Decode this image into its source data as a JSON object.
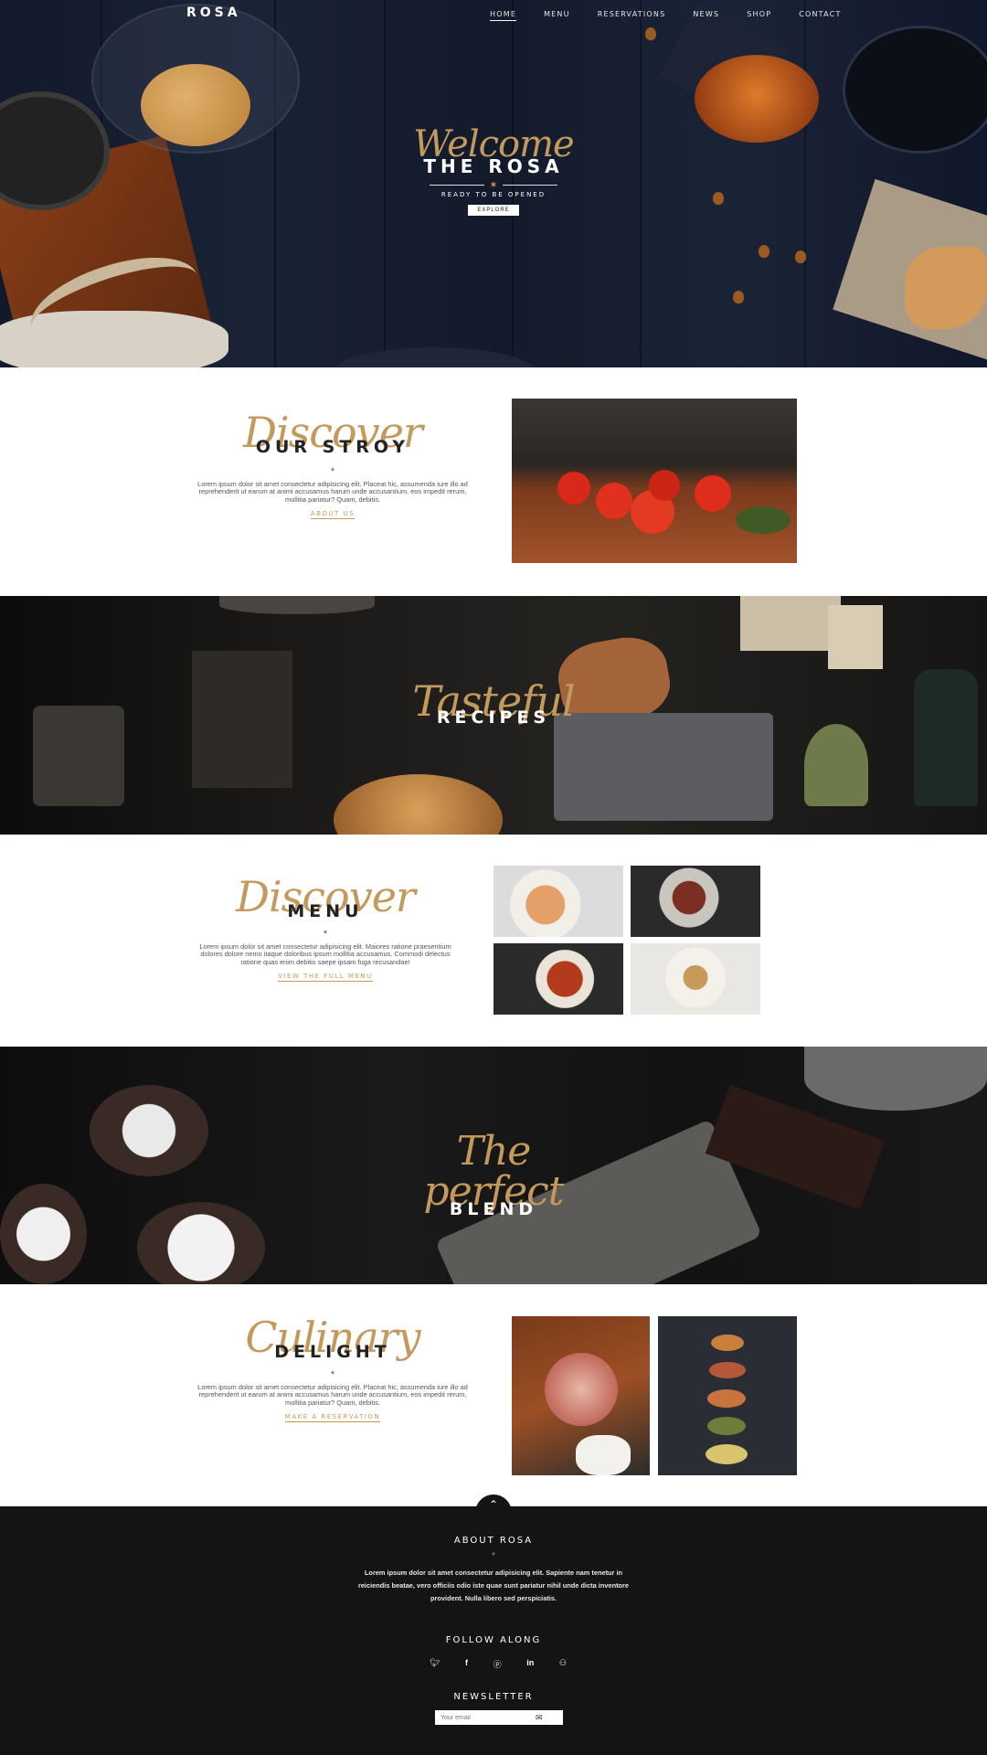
{
  "nav": {
    "logo": "ROSA",
    "items": [
      "HOME",
      "MENU",
      "RESERVATIONS",
      "NEWS",
      "SHOP",
      "CONTACT"
    ],
    "active": "HOME"
  },
  "hero": {
    "script": "Welcome",
    "title": "THE ROSA",
    "subtitle": "READY TO BE OPENED",
    "button": "EXPLORE"
  },
  "story": {
    "script": "Discover",
    "title": "OUR STROY",
    "star": "*",
    "text": "Lorem ipsum dolor sit amet consectetur adipisicing elit. Placeat hic, assumenda iure illo ad reprehenderit ut earum at animi accusamus harum unde accusantium, eos impedit rerum, mollitia pariatur? Quam, debitis.",
    "link": "ABOUT US"
  },
  "recipes": {
    "script": "Tasteful",
    "title": "RECIPES"
  },
  "menu": {
    "script": "Discover",
    "title": "MENU",
    "star": "*",
    "text": "Lorem ipsum dolor sit amet consectetur adipisicing elit. Maiores ratione praesentium dolores dolore nemo itaque doloribus ipsum mollitia accusamus. Commodi delectus ratione quas enim debitis saepe ipsam fuga recusandae!",
    "link": "VIEW THE FULL MENU"
  },
  "blend": {
    "script": "The perfect",
    "title": "BLEND"
  },
  "delight": {
    "script": "Culinary",
    "title": "DELIGHT",
    "star": "*",
    "text": "Lorem ipsum dolor sit amet consectetur adipisicing elit. Placeat hic, assumenda iure illo ad reprehenderit ut earum at animi accusamus harum unde accusantium, eos impedit rerum, mollitia pariatur? Quam, debitis.",
    "link": "MAKE A RESERVATION"
  },
  "footer": {
    "about_title": "ABOUT ROSA",
    "star": "*",
    "about_text": "Lorem ipsum dolor sit amet consectetur adipisicing elit. Sapiente nam tenetur in reiciendis beatae, vero officiis odio iste quae sunt pariatur nihil unde dicta inventore provident. Nulla libero sed perspiciatis.",
    "follow_title": "FOLLOW ALONG",
    "social_icons": [
      "twitter-icon",
      "facebook-icon",
      "pinterest-icon",
      "linkedin-icon",
      "tripadvisor-icon"
    ],
    "newsletter_title": "NEWSLETTER",
    "email_placeholder": "Your email"
  },
  "colors": {
    "accent": "#c49a5c",
    "footer_bg": "#141414",
    "hero_bg": "#151c2e"
  }
}
